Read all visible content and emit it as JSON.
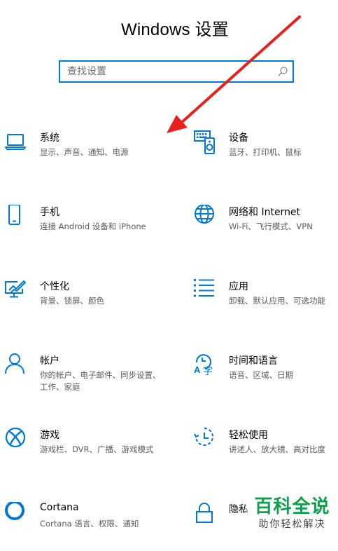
{
  "page": {
    "title": "Windows 设置",
    "accent": "#0078d7"
  },
  "search": {
    "placeholder": "查找设置",
    "icon": "search-icon"
  },
  "tiles": [
    {
      "name": "系统",
      "desc": "显示、声音、通知、电源",
      "icon": "laptop-icon"
    },
    {
      "name": "设备",
      "desc": "蓝牙、打印机、鼠标",
      "icon": "keyboard-speaker-icon"
    },
    {
      "name": "手机",
      "desc": "连接 Android 设备和 iPhone",
      "icon": "phone-icon"
    },
    {
      "name": "网络和 Internet",
      "desc": "Wi-Fi、飞行模式、VPN",
      "icon": "globe-icon"
    },
    {
      "name": "个性化",
      "desc": "背景、锁屏、颜色",
      "icon": "paint-brush-icon"
    },
    {
      "name": "应用",
      "desc": "卸载、默认应用、可选功能",
      "icon": "app-list-icon"
    },
    {
      "name": "帐户",
      "desc": "你的帐户、电子邮件、同步设置、工作、家庭",
      "icon": "person-icon"
    },
    {
      "name": "时间和语言",
      "desc": "语音、区域、日期",
      "icon": "time-language-icon"
    },
    {
      "name": "游戏",
      "desc": "游戏栏、DVR、广播、游戏模式",
      "icon": "xbox-icon"
    },
    {
      "name": "轻松使用",
      "desc": "讲述人、放大镜、高对比度",
      "icon": "ease-of-access-icon"
    },
    {
      "name": "Cortana",
      "desc": "Cortana 语言、权限、通知",
      "icon": "cortana-icon"
    },
    {
      "name": "隐私",
      "desc": "",
      "icon": "lock-icon"
    }
  ],
  "annotation": {
    "color": "#e8211d"
  },
  "watermark": {
    "main": "百科全说",
    "sub": "助你轻松解决",
    "color": "#0f9e4b"
  }
}
